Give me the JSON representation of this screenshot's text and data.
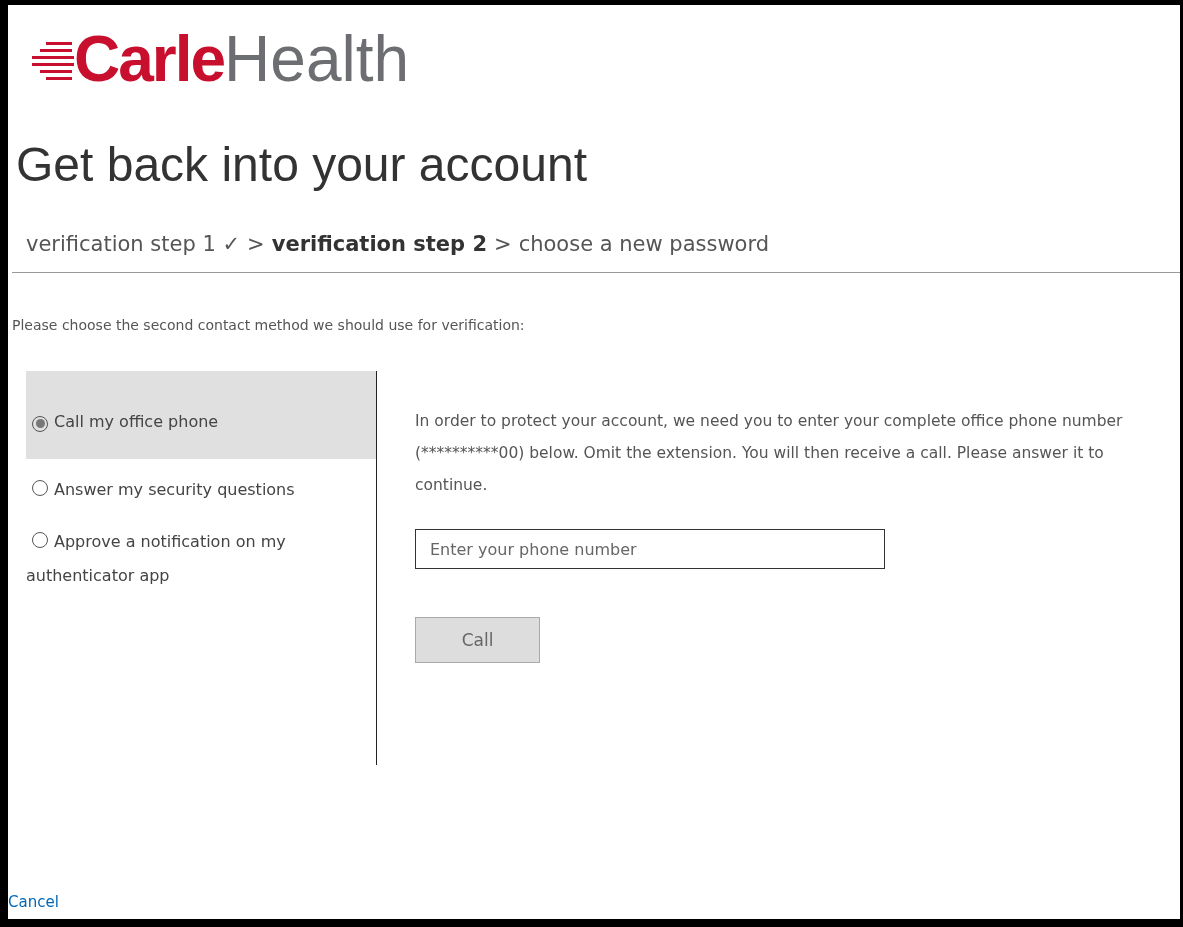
{
  "logo": {
    "brand": "Carle",
    "suffix": "Health"
  },
  "title": "Get back into your account",
  "steps": [
    {
      "label": "verification step 1 ✓",
      "current": false
    },
    {
      "label": "verification step 2",
      "current": true
    },
    {
      "label": "choose a new password",
      "current": false
    }
  ],
  "step_separator": ">",
  "instruction": "Please choose the second contact method we should use for verification:",
  "methods": [
    {
      "label": "Call my office phone",
      "selected": true
    },
    {
      "label": "Answer my security questions",
      "selected": false
    },
    {
      "label": "Approve a notification on my authenticator app",
      "selected": false
    }
  ],
  "description": "In order to protect your account, we need you to enter your complete office phone number (**********00) below. Omit the extension. You will then receive a call. Please answer it to continue.",
  "phone_field": {
    "placeholder": "Enter your phone number",
    "disabled_button": true,
    "button": "Call"
  },
  "cancel_link": "Cancel"
}
